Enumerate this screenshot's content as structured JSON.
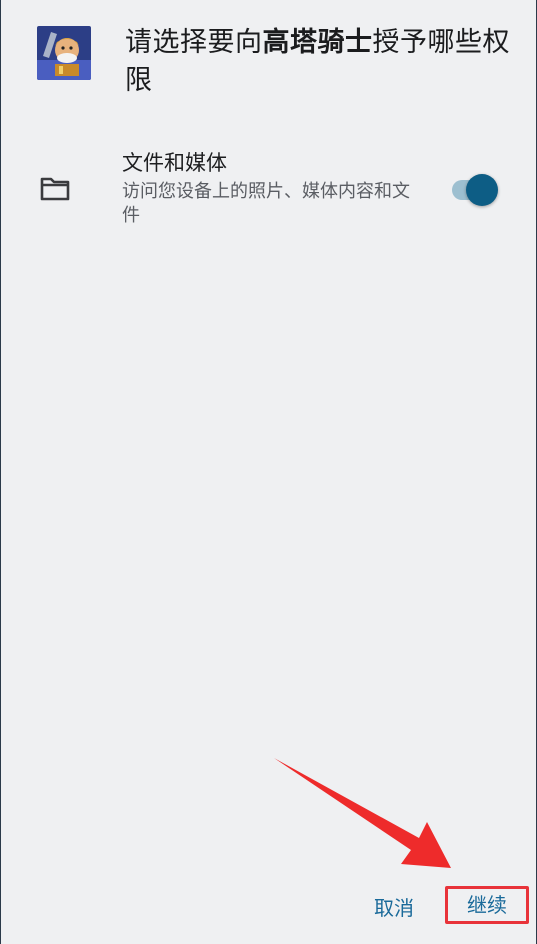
{
  "dialog": {
    "title_prefix": "请选择要向",
    "app_name": "高塔骑士",
    "title_suffix": "授予哪些权限",
    "app_icon": "game-knight-icon"
  },
  "permission": {
    "icon": "folder-icon",
    "title": "文件和媒体",
    "description": "访问您设备上的照片、媒体内容和文件",
    "enabled": true
  },
  "buttons": {
    "cancel_label": "取消",
    "continue_label": "继续"
  },
  "colors": {
    "background": "#eff0f2",
    "accent": "#1a6a9a",
    "toggle_thumb": "#0d5d85",
    "toggle_track": "#9dbfd0",
    "highlight": "#e8333a"
  }
}
